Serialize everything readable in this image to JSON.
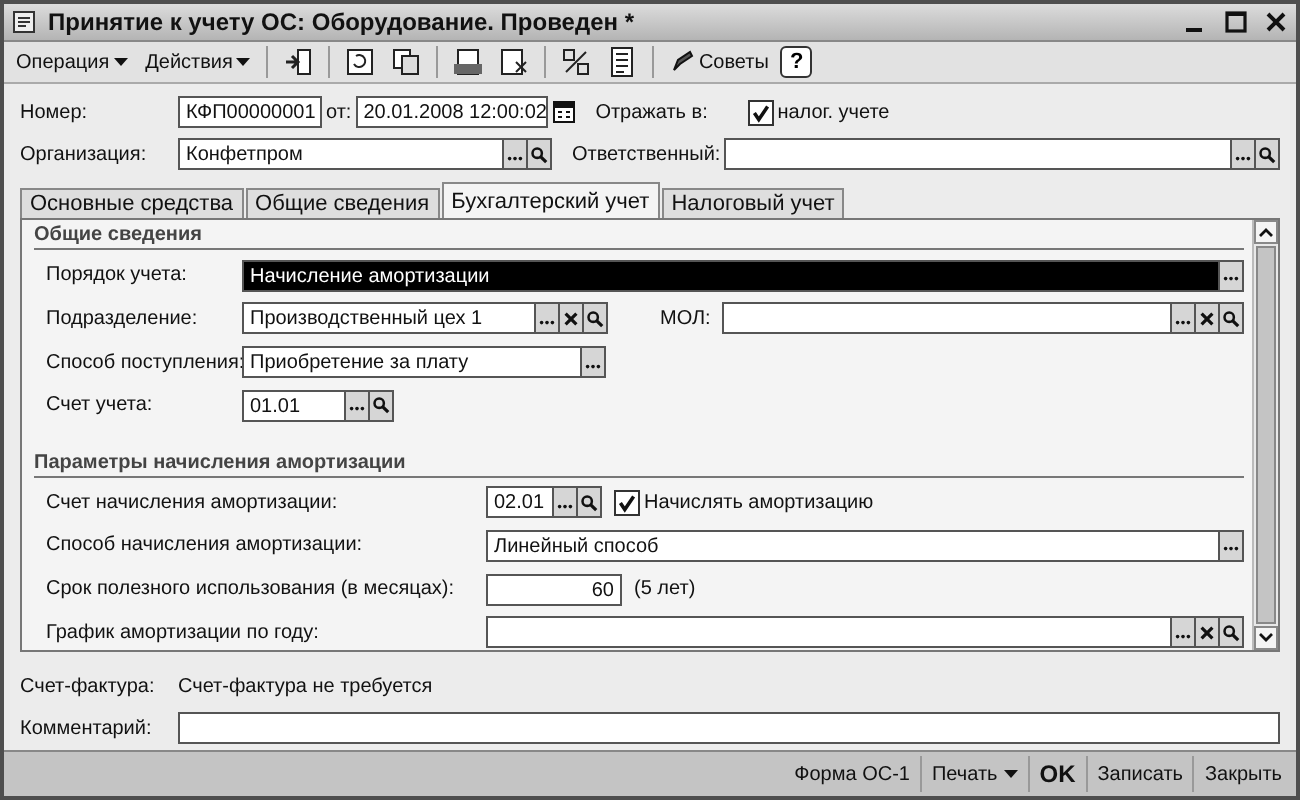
{
  "window": {
    "title": "Принятие к учету ОС: Оборудование. Проведен *"
  },
  "toolbar": {
    "menus": [
      {
        "label": "Операция"
      },
      {
        "label": "Действия"
      }
    ],
    "advice": "Советы",
    "help": "?"
  },
  "header": {
    "number": {
      "label": "Номер:",
      "value": "КФП00000001"
    },
    "date": {
      "label": "от:",
      "value": "20.01.2008 12:00:02"
    },
    "reflect": {
      "label": "Отражать в:",
      "option": "налог. учете",
      "checked": true
    },
    "organization": {
      "label": "Организация:",
      "value": "Конфетпром",
      "buttons": [
        {
          "kind": "select"
        },
        {
          "kind": "search"
        }
      ]
    },
    "responsible": {
      "label": "Ответственный:",
      "buttons": [
        {
          "kind": "select"
        },
        {
          "kind": "search"
        }
      ]
    }
  },
  "tabs": [
    {
      "label": "Основные средства",
      "selected": false
    },
    {
      "label": "Общие сведения",
      "selected": false
    },
    {
      "label": "Бухгалтерский учет",
      "selected": true
    },
    {
      "label": "Налоговый учет",
      "selected": false
    }
  ],
  "general": {
    "title": "Общие сведения",
    "order": {
      "label": "Порядок учета:",
      "value": "Начисление амортизации",
      "focused": true,
      "buttons": [
        {
          "kind": "select"
        }
      ]
    },
    "division": {
      "label": "Подразделение:",
      "value": "Производственный цех 1",
      "buttons": [
        {
          "kind": "select"
        },
        {
          "kind": "clear"
        },
        {
          "kind": "search"
        }
      ]
    },
    "mol": {
      "label": "МОЛ:",
      "buttons": [
        {
          "kind": "select"
        },
        {
          "kind": "clear"
        },
        {
          "kind": "search"
        }
      ]
    },
    "receipt": {
      "label": "Способ поступления:",
      "value": "Приобретение за плату",
      "buttons": [
        {
          "kind": "select"
        }
      ]
    },
    "account": {
      "label": "Счет учета:",
      "value": "01.01",
      "buttons": [
        {
          "kind": "select"
        },
        {
          "kind": "search"
        }
      ]
    }
  },
  "depreciation": {
    "title": "Параметры начисления амортизации",
    "account": {
      "label": "Счет начисления амортизации:",
      "value": "02.01",
      "buttons": [
        {
          "kind": "select"
        },
        {
          "kind": "search"
        }
      ]
    },
    "accrue": {
      "label": "Начислять амортизацию",
      "checked": true
    },
    "method": {
      "label": "Способ начисления амортизации:",
      "value": "Линейный способ",
      "buttons": [
        {
          "kind": "select"
        }
      ]
    },
    "life": {
      "label": "Срок полезного использования (в месяцах):",
      "value": "60",
      "note": "(5 лет)"
    },
    "schedule": {
      "label": "График амортизации по году:",
      "buttons": [
        {
          "kind": "select"
        },
        {
          "kind": "clear"
        },
        {
          "kind": "search"
        }
      ]
    }
  },
  "invoice": {
    "label": "Счет-фактура:",
    "value": "Счет-фактура не требуется"
  },
  "comment": {
    "label": "Комментарий:"
  },
  "footer": {
    "buttons": [
      {
        "label": "Форма ОС-1",
        "kind": "plain"
      },
      {
        "label": "Печать",
        "kind": "menu"
      },
      {
        "label": "OK",
        "kind": "default"
      },
      {
        "label": "Записать",
        "kind": "plain"
      },
      {
        "label": "Закрыть",
        "kind": "plain"
      }
    ]
  }
}
